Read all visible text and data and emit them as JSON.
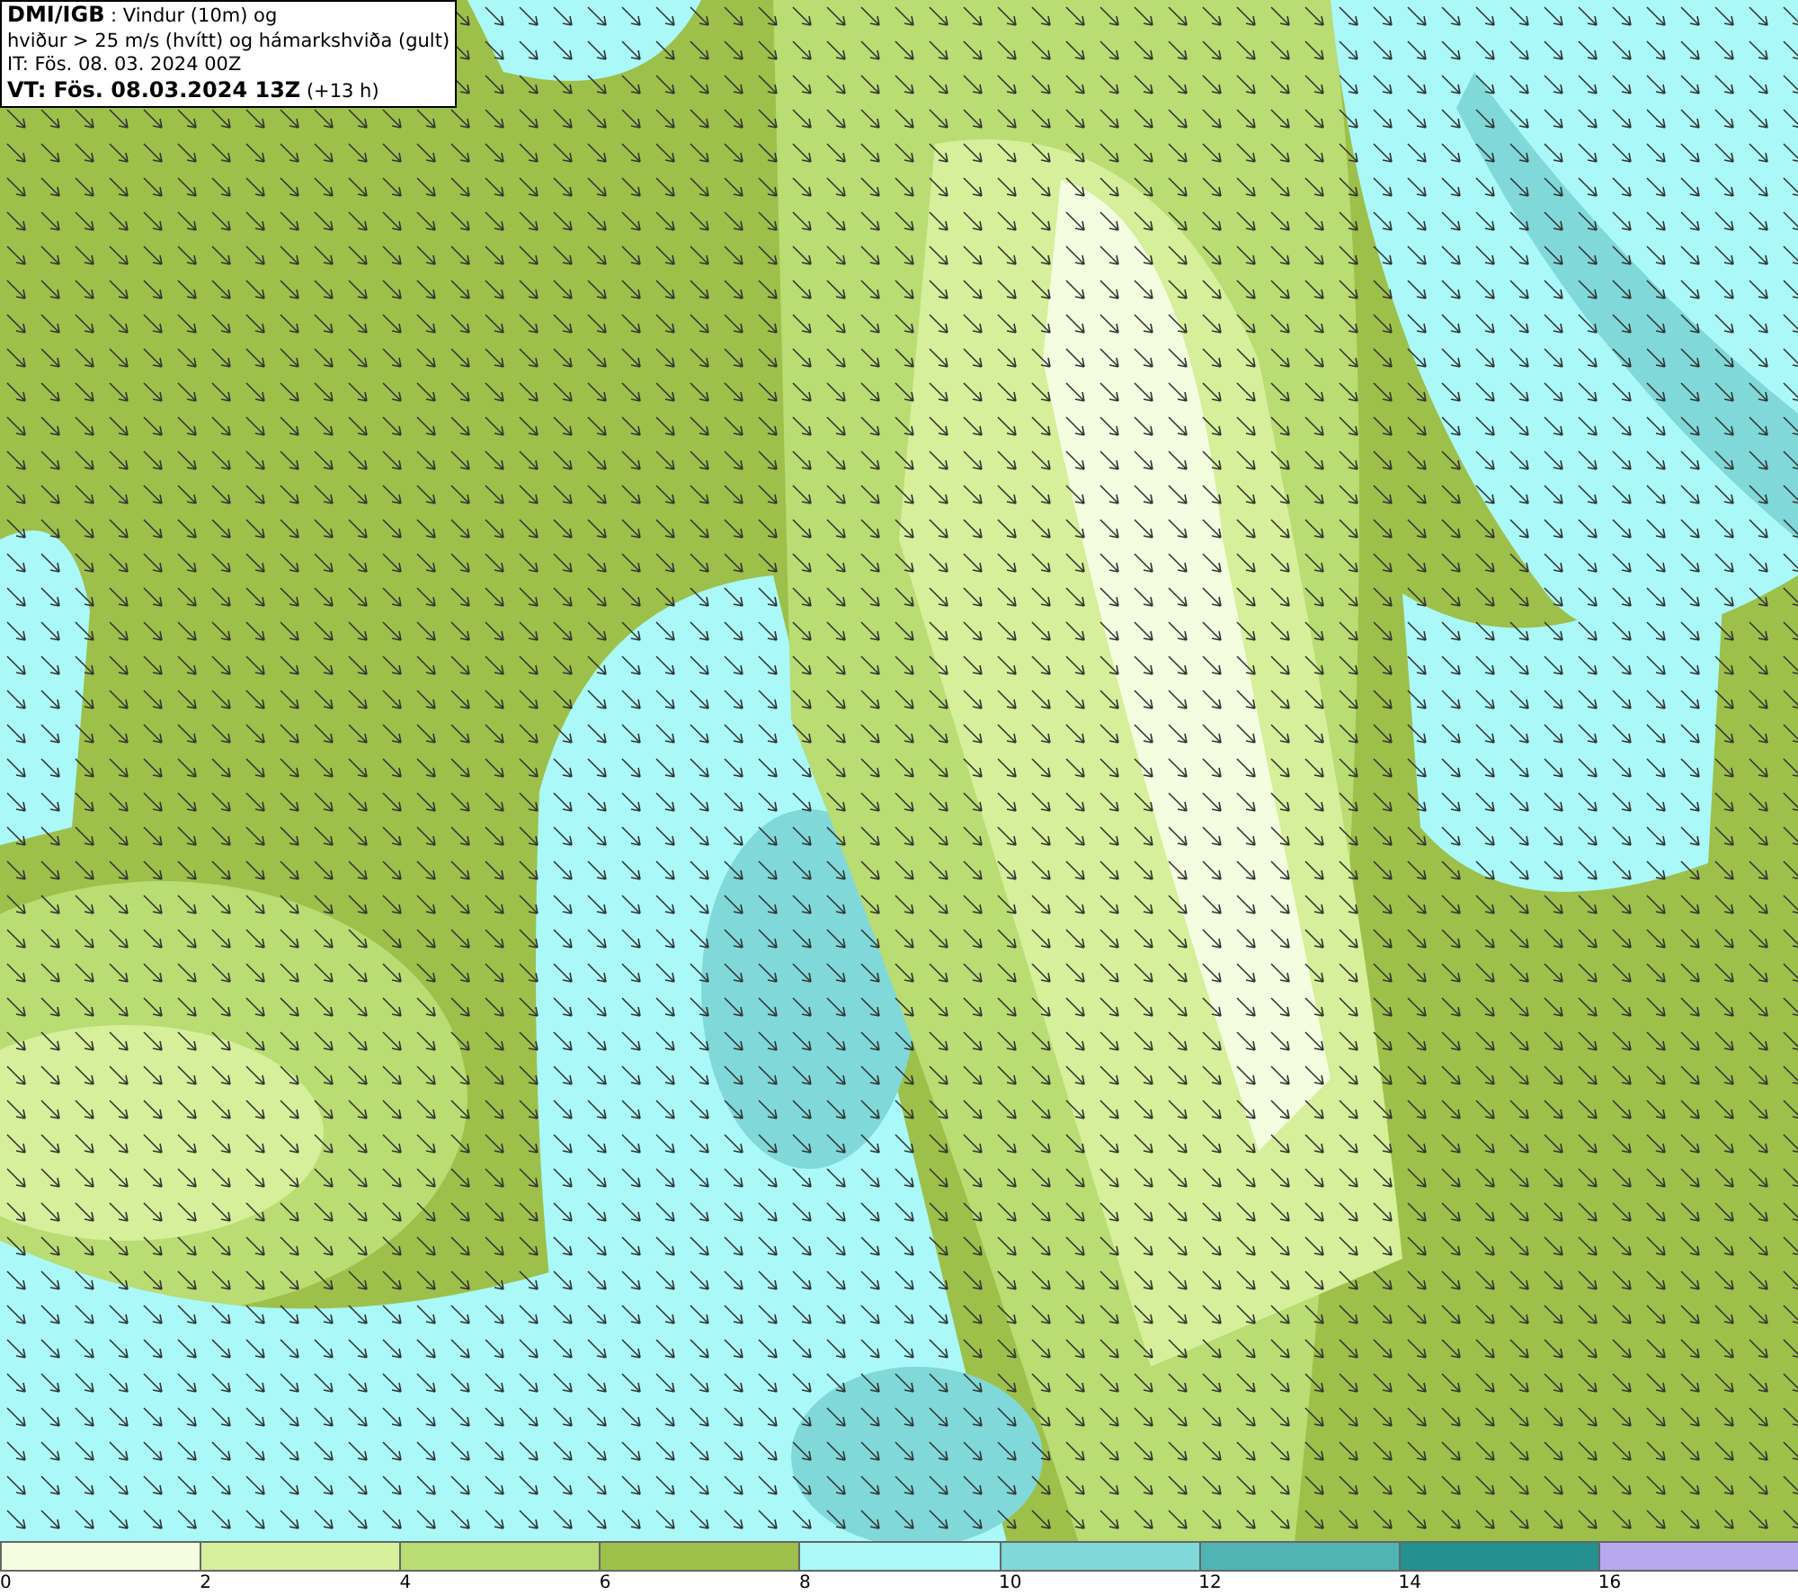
{
  "header": {
    "lines": [
      "**DMI/IGB** : Vindur (10m) og",
      "hviður > 25 m/s (hvítt) og hámarkshviða (gult)",
      "IT: Fös. 08. 03. 2024 00Z",
      "**VT: Fös. 08.03.2024 13Z** (+13 h)"
    ]
  },
  "legend": {
    "segments": [
      {
        "color": "#f4fde0"
      },
      {
        "color": "#d5ef9a"
      },
      {
        "color": "#b9dc73"
      },
      {
        "color": "#9cc04a"
      },
      {
        "color": "#aaf8f8"
      },
      {
        "color": "#80d8d8"
      },
      {
        "color": "#50b4b4"
      },
      {
        "color": "#249090"
      },
      {
        "color": "#b8a8f0"
      }
    ],
    "ticks": [
      "0",
      "2",
      "4",
      "6",
      "8",
      "10",
      "12",
      "14",
      "16"
    ]
  }
}
